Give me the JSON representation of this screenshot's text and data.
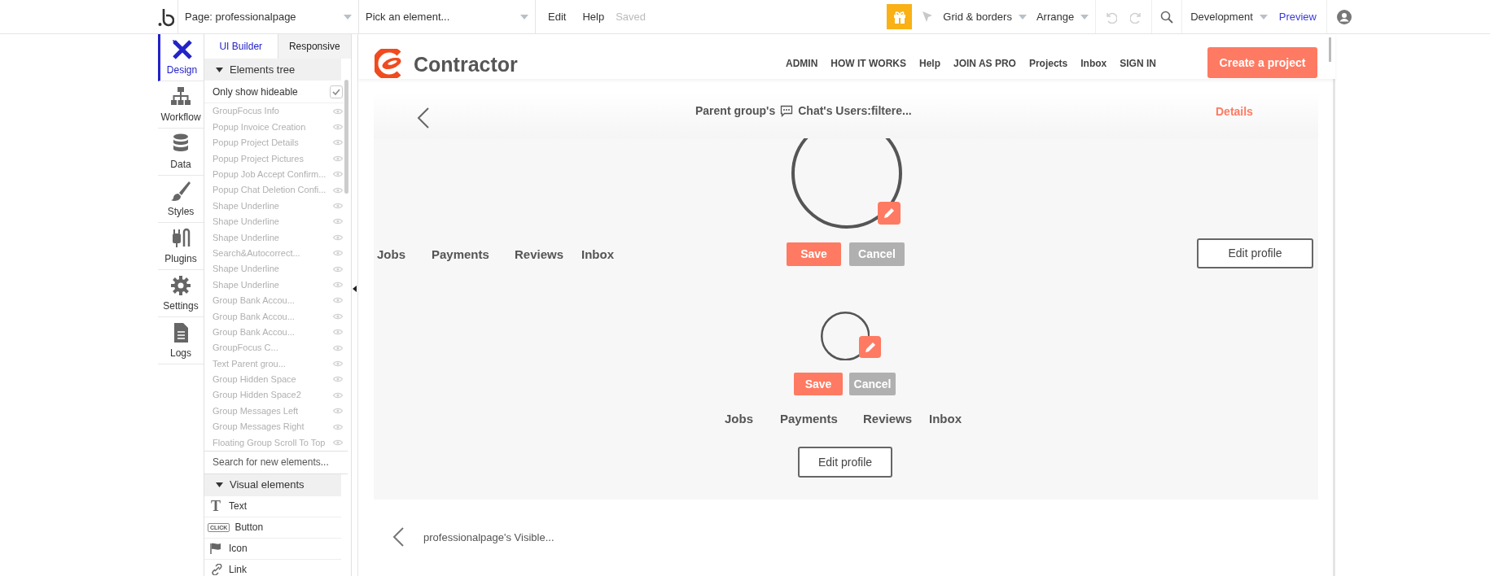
{
  "toolbar": {
    "page_selector": "Page: professionalpage",
    "element_picker": "Pick an element...",
    "menu": [
      "Edit",
      "Help"
    ],
    "save_status": "Saved",
    "grid": "Grid & borders",
    "arrange": "Arrange",
    "mode": "Development",
    "preview": "Preview"
  },
  "sidebar": [
    {
      "kind": "design",
      "label": "Design",
      "selected": true
    },
    {
      "kind": "workflow",
      "label": "Workflow",
      "selected": false
    },
    {
      "kind": "data",
      "label": "Data",
      "selected": false
    },
    {
      "kind": "styles",
      "label": "Styles",
      "selected": false
    },
    {
      "kind": "plugins",
      "label": "Plugins",
      "selected": false
    },
    {
      "kind": "settings",
      "label": "Settings",
      "selected": false
    },
    {
      "kind": "logs",
      "label": "Logs",
      "selected": false
    }
  ],
  "panel": {
    "tabs": [
      {
        "label": "UI Builder",
        "selected": true
      },
      {
        "label": "Responsive",
        "selected": false
      }
    ],
    "tree_header": "Elements tree",
    "filter": {
      "label": "Only show hideable",
      "checked": true
    },
    "tree_items": [
      "GroupFocus Info",
      "Popup Invoice Creation",
      "Popup Project Details",
      "Popup Project Pictures",
      "Popup Job Accept Confirm...",
      "Popup Chat Deletion Confi...",
      "Shape Underline",
      "Shape Underline",
      "Shape Underline",
      "Search&Autocorrect...",
      "Shape Underline",
      "Shape Underline",
      "Group Bank Accou...",
      "Group Bank Accou...",
      "Group Bank Accou...",
      "GroupFocus C...",
      "Text Parent grou...",
      "Group Hidden Space",
      "Group Hidden Space2",
      "Group Messages Left",
      "Group Messages Right",
      "Floating Group Scroll To Top"
    ],
    "search": {
      "placeholder": "Search for new elements..."
    },
    "visual_header": "Visual elements",
    "visual_elements": [
      {
        "kind": "text",
        "label": "Text",
        "icon_text": "T"
      },
      {
        "kind": "button",
        "label": "Button",
        "icon_text": "CLICK"
      },
      {
        "kind": "icon",
        "label": "Icon"
      },
      {
        "kind": "link",
        "label": "Link"
      }
    ]
  },
  "canvas": {
    "header": {
      "brand": "Contractor",
      "nav": [
        "ADMIN",
        "HOW IT WORKS",
        "Help",
        "JOIN AS PRO",
        "Projects",
        "Inbox",
        "SIGN IN"
      ],
      "cta": "Create a project"
    },
    "chat_header": {
      "title_start": "Parent group's",
      "title_end": "Chat's Users:filtere...",
      "action": "Details"
    },
    "profile_large": {
      "save": "Save",
      "cancel": "Cancel",
      "tabs": [
        "Jobs",
        "Payments",
        "Reviews",
        "Inbox"
      ],
      "edit": "Edit profile"
    },
    "profile_small": {
      "save": "Save",
      "cancel": "Cancel",
      "tabs": [
        "Jobs",
        "Payments",
        "Reviews",
        "Inbox"
      ],
      "edit": "Edit profile"
    },
    "footer": {
      "text": "professionalpage's Visible..."
    }
  }
}
